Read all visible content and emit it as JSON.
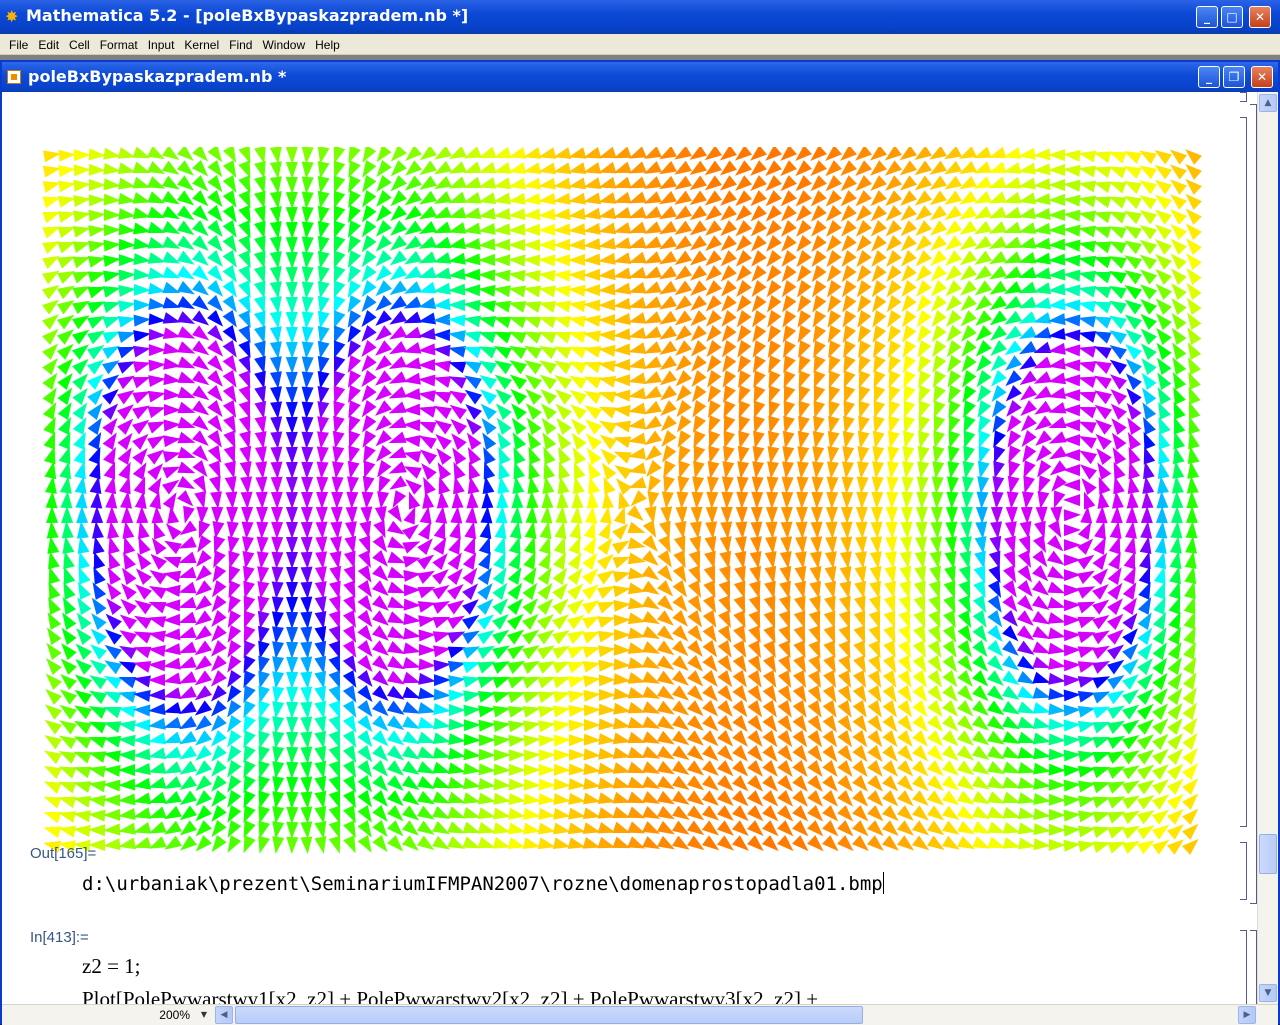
{
  "app": {
    "title": "Mathematica 5.2 - [poleBxBypaskazpradem.nb *]",
    "menu": [
      "File",
      "Edit",
      "Cell",
      "Format",
      "Input",
      "Kernel",
      "Find",
      "Window",
      "Help"
    ]
  },
  "notebook": {
    "title": "poleBxBypaskazpradem.nb *",
    "out_label": "Out[165]=",
    "out_text": "d:\\urbaniak\\prezent\\SeminariumIFMPAN2007\\rozne\\domenaprostopadla01.bmp",
    "in_label": "In[413]:=",
    "in_line1": "z2 = 1;",
    "in_line2": "Plot[PolePwwarstwy1[x2, z2] + PolePwwarstwy2[x2, z2] + PolePwwarstwy3[x2, z2] +"
  },
  "status": {
    "zoom": "200%"
  },
  "colors": {
    "titlebar": "#0c49d6",
    "accent_label": "#36558a"
  }
}
